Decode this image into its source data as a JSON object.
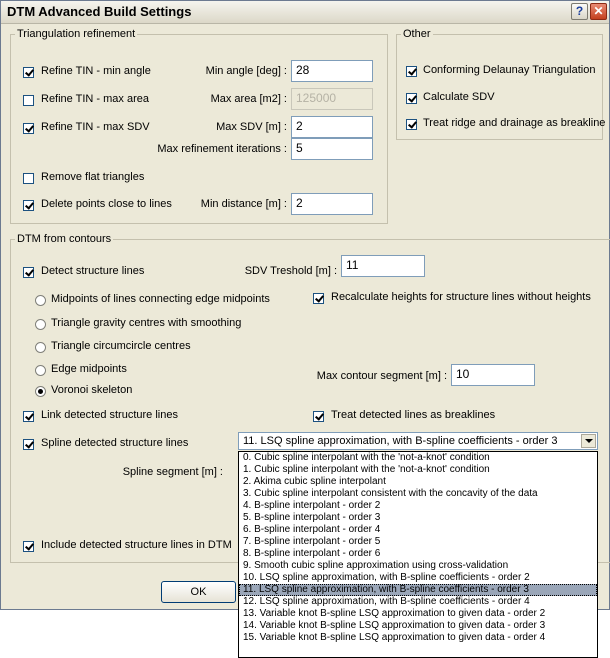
{
  "window": {
    "title": "DTM Advanced Build Settings",
    "help_glyph": "?",
    "close_glyph": "✕"
  },
  "triangulation": {
    "group_label": "Triangulation refinement",
    "refine_min_angle": {
      "label": "Refine TIN - min angle",
      "checked": true,
      "field_label": "Min angle [deg] :",
      "value": "28"
    },
    "refine_max_area": {
      "label": "Refine TIN - max area",
      "checked": false,
      "field_label": "Max area [m2] :",
      "value": "125000",
      "disabled": true
    },
    "refine_max_sdv": {
      "label": "Refine TIN - max SDV",
      "checked": true,
      "field_label": "Max SDV [m] :",
      "value": "2"
    },
    "max_iterations": {
      "field_label": "Max refinement iterations :",
      "value": "5"
    },
    "remove_flat": {
      "label": "Remove flat triangles",
      "checked": false
    },
    "delete_points": {
      "label": "Delete points close to lines",
      "checked": true,
      "field_label": "Min distance [m] :",
      "value": "2"
    }
  },
  "other": {
    "group_label": "Other",
    "conforming": {
      "label": "Conforming Delaunay Triangulation",
      "checked": true
    },
    "calculate_sdv": {
      "label": "Calculate SDV",
      "checked": true
    },
    "treat_ridge": {
      "label": "Treat ridge and drainage as breakline",
      "checked": true
    }
  },
  "contours": {
    "group_label": "DTM from contours",
    "detect": {
      "label": "Detect structure lines",
      "checked": true
    },
    "sdv_threshold": {
      "field_label": "SDV Treshold [m] :",
      "value": "11"
    },
    "recalculate": {
      "label": "Recalculate heights for structure lines without heights",
      "checked": true
    },
    "radios": [
      {
        "label": "Midpoints of lines connecting edge midpoints",
        "selected": false
      },
      {
        "label": "Triangle  gravity centres with smoothing",
        "selected": false
      },
      {
        "label": "Triangle circumcircle centres",
        "selected": false
      },
      {
        "label": "Edge midpoints",
        "selected": false
      },
      {
        "label": "Voronoi skeleton",
        "selected": true
      }
    ],
    "max_contour_segment": {
      "field_label": "Max contour segment [m] :",
      "value": "10"
    },
    "link": {
      "label": "Link detected structure lines",
      "checked": true
    },
    "treat_breaklines": {
      "label": "Treat detected lines as breaklines",
      "checked": true
    },
    "spline": {
      "label": "Spline detected structure lines",
      "checked": true
    },
    "spline_segment_label": "Spline segment [m] :",
    "include": {
      "label": "Include detected structure lines in DTM",
      "checked": true
    },
    "spline_method": {
      "selected": "11. LSQ spline approximation, with B-spline coefficients - order 3",
      "selected_index": 11,
      "options": [
        "0. Cubic spline interpolant with the 'not-a-knot' condition",
        "1. Cubic spline interpolant with the 'not-a-knot' condition",
        "2. Akima cubic spline interpolant",
        "3. Cubic spline interpolant consistent with the concavity of the data",
        "4. B-spline interpolant - order 2",
        "5. B-spline interpolant - order 3",
        "6. B-spline interpolant - order 4",
        "7. B-spline interpolant - order 5",
        "8. B-spline interpolant - order 6",
        "9. Smooth cubic spline approximation using cross-validation",
        "10. LSQ spline approximation, with B-spline coefficients - order 2",
        "11. LSQ spline approximation, with B-spline coefficients - order 3",
        "12. LSQ spline approximation, with B-spline coefficients - order 4",
        "13. Variable knot B-spline LSQ approximation to given data - order 2",
        "14. Variable knot B-spline LSQ approximation to given data - order 3",
        "15. Variable knot B-spline LSQ approximation to given data - order 4"
      ]
    }
  },
  "footer": {
    "ok_label": "OK"
  }
}
